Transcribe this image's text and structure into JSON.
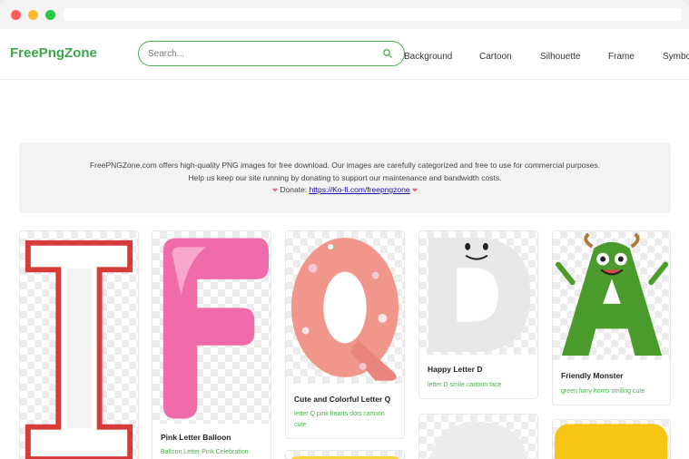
{
  "header": {
    "logo": "FreePngZone",
    "search_placeholder": "Search...",
    "nav": [
      "Background",
      "Cartoon",
      "Silhouette",
      "Frame",
      "Symbo"
    ]
  },
  "banner": {
    "line1": "FreePNGZone.com offers high-quality PNG images for free download. Our images are carefully categorized and free to use for commercial purposes.",
    "line2": "Help us keep our site running by donating to support our maintenance and bandwidth costs.",
    "donate_label": "Donate:",
    "donate_link": "https://Ko-fi.com/freepngzone"
  },
  "cards": [
    {
      "title": "",
      "tags": ""
    },
    {
      "title": "Pink Letter Balloon",
      "tags": "Balloon Letter Pink Celebration"
    },
    {
      "title": "Cute and Colorful Letter Q",
      "tags": "letter Q pink hearts dots cartoon cute"
    },
    {
      "title": "Happy Letter D",
      "tags": "letter D smile cartoon face"
    },
    {
      "title": "Friendly Monster",
      "tags": "green furry horns smiling cute"
    }
  ],
  "colors": {
    "brand": "#3aa84a",
    "tag": "#4caf50",
    "link": "#1a0dab"
  }
}
